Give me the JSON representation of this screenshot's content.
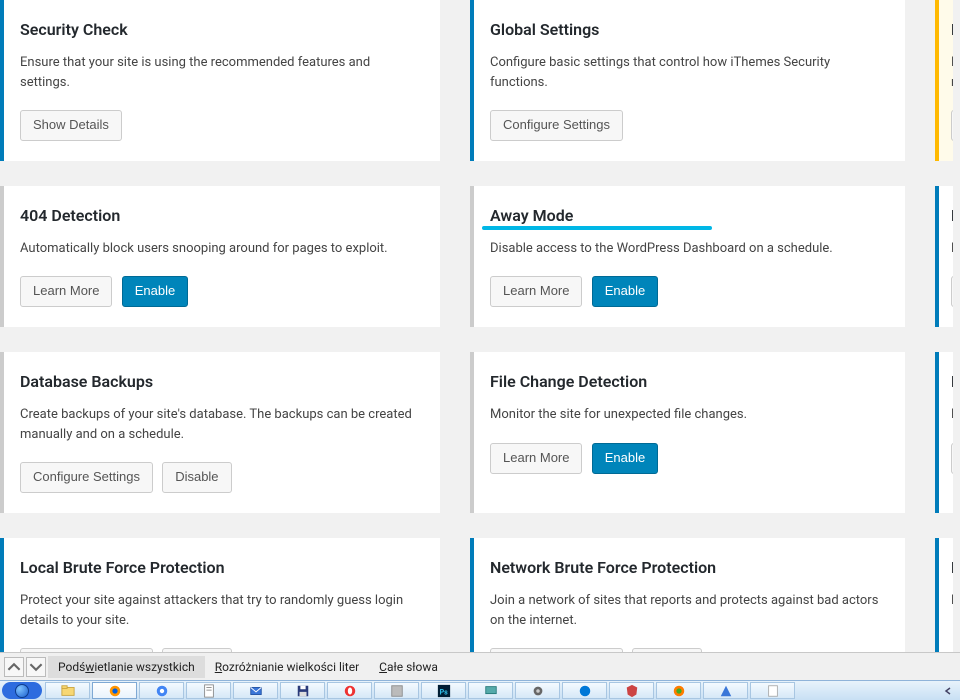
{
  "buttons": {
    "show_details": "Show Details",
    "configure_settings": "Configure Settings",
    "learn_more": "Learn More",
    "enable": "Enable",
    "disable": "Disable"
  },
  "cards": {
    "security_check": {
      "title": "Security Check",
      "desc": "Ensure that your site is using the recommended features and settings."
    },
    "global_settings": {
      "title": "Global Settings",
      "desc": "Configure basic settings that control how iThemes Security functions."
    },
    "notifications": {
      "title_prefix": "N",
      "desc_line1": "Ma",
      "desc_line2": "rel"
    },
    "detection_404": {
      "title": "404 Detection",
      "desc": "Automatically block users snooping around for pages to exploit."
    },
    "away_mode": {
      "title": "Away Mode",
      "desc": "Disable access to the WordPress Dashboard on a schedule."
    },
    "banned_users": {
      "title_prefix": "Ba",
      "desc_prefix": "Bl"
    },
    "database_backups": {
      "title": "Database Backups",
      "desc": "Create backups of your site's database. The backups can be created manually and on a schedule."
    },
    "file_change": {
      "title": "File Change Detection",
      "desc": "Monitor the site for unexpected file changes."
    },
    "file_perms": {
      "title_prefix": "Fil",
      "desc_prefix": "Lis",
      "btn_prefix": "S"
    },
    "local_brute": {
      "title": "Local Brute Force Protection",
      "desc": "Protect your site against attackers that try to randomly guess login details to your site."
    },
    "network_brute": {
      "title": "Network Brute Force Protection",
      "desc": "Join a network of sites that reports and protects against bad actors on the internet."
    },
    "passwords": {
      "title_prefix": "Pa",
      "desc_prefix": "Ma"
    }
  },
  "find_bar": {
    "highlight_all": "Podświetlanie wszystkich",
    "highlight_all_u": "w",
    "match_case": "Rozróżnianie wielkości liter",
    "match_case_u": "R",
    "whole_words": "Całe słowa",
    "whole_words_u": "C"
  }
}
